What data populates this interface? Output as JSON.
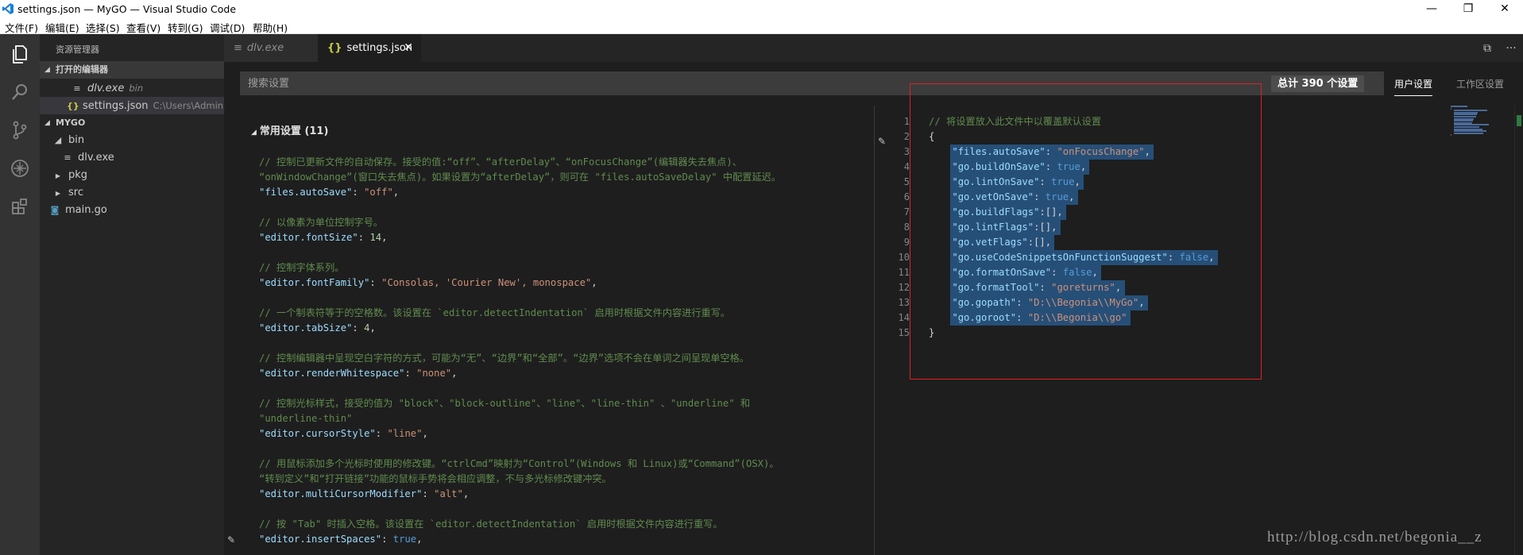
{
  "window": {
    "title": "settings.json — MyGO — Visual Studio Code",
    "controls": {
      "minimize": "—",
      "maximize": "❐",
      "close": "✕"
    }
  },
  "menu": [
    "文件(F)",
    "编辑(E)",
    "选择(S)",
    "查看(V)",
    "转到(G)",
    "调试(D)",
    "帮助(H)"
  ],
  "activity_bar": [
    "files-icon",
    "search-icon",
    "source-control-icon",
    "debug-icon",
    "extensions-icon"
  ],
  "sidebar": {
    "title": "资源管理器",
    "open_editors": {
      "label": "打开的编辑器",
      "items": [
        {
          "name": "dlv.exe",
          "desc": "bin",
          "icon": "≡"
        },
        {
          "name": "settings.json",
          "desc": "C:\\Users\\Adminis...",
          "icon": "{}"
        }
      ]
    },
    "workspace": {
      "label": "MYGO",
      "items": [
        {
          "name": "bin",
          "arrow": "◢"
        },
        {
          "name": "dlv.exe",
          "icon": "≡"
        },
        {
          "name": "pkg",
          "arrow": "▶"
        },
        {
          "name": "src",
          "arrow": "▶"
        },
        {
          "name": "main.go",
          "icon": "◙"
        }
      ]
    }
  },
  "tabs": [
    {
      "label": "dlv.exe",
      "icon": "≡"
    },
    {
      "label": "settings.json",
      "icon": "{}",
      "close": "✕"
    }
  ],
  "tab_actions": {
    "split": "⧉",
    "more": "···"
  },
  "settings": {
    "search_placeholder": "搜索设置",
    "count": "总计 390 个设置",
    "user_tab": "用户设置",
    "workspace_tab": "工作区设置"
  },
  "default_settings": {
    "group_header": "常用设置 (11)",
    "lines": [
      [
        {
          "t": "// 控制已更新文件的自动保存。接受的值:“off”、“afterDelay”、“onFocusChange”(编辑器失去焦点)、",
          "c": "cm"
        }
      ],
      [
        {
          "t": "“onWindowChange”(窗口失去焦点)。如果设置为“afterDelay”，则可在 \"files.autoSaveDelay\" 中配置延迟。",
          "c": "cm"
        }
      ],
      [
        {
          "t": "\"files.autoSave\"",
          "c": "ky"
        },
        {
          "t": ": ",
          "c": "pn"
        },
        {
          "t": "\"off\"",
          "c": "st"
        },
        {
          "t": ",",
          "c": "pn"
        }
      ],
      [],
      [
        {
          "t": "// 以像素为单位控制字号。",
          "c": "cm"
        }
      ],
      [
        {
          "t": "\"editor.fontSize\"",
          "c": "ky"
        },
        {
          "t": ": ",
          "c": "pn"
        },
        {
          "t": "14",
          "c": "nm"
        },
        {
          "t": ",",
          "c": "pn"
        }
      ],
      [],
      [
        {
          "t": "// 控制字体系列。",
          "c": "cm"
        }
      ],
      [
        {
          "t": "\"editor.fontFamily\"",
          "c": "ky"
        },
        {
          "t": ": ",
          "c": "pn"
        },
        {
          "t": "\"Consolas, 'Courier New', monospace\"",
          "c": "st"
        },
        {
          "t": ",",
          "c": "pn"
        }
      ],
      [],
      [
        {
          "t": "// 一个制表符等于的空格数。该设置在 `editor.detectIndentation` 启用时根据文件内容进行重写。",
          "c": "cm"
        }
      ],
      [
        {
          "t": "\"editor.tabSize\"",
          "c": "ky"
        },
        {
          "t": ": ",
          "c": "pn"
        },
        {
          "t": "4",
          "c": "nm"
        },
        {
          "t": ",",
          "c": "pn"
        }
      ],
      [],
      [
        {
          "t": "// 控制编辑器中呈现空白字符的方式，可能为“无”、“边界”和“全部”。“边界”选项不会在单词之间呈现单空格。",
          "c": "cm"
        }
      ],
      [
        {
          "t": "\"editor.renderWhitespace\"",
          "c": "ky"
        },
        {
          "t": ": ",
          "c": "pn"
        },
        {
          "t": "\"none\"",
          "c": "st"
        },
        {
          "t": ",",
          "c": "pn"
        }
      ],
      [],
      [
        {
          "t": "// 控制光标样式，接受的值为 \"block\"、\"block-outline\"、\"line\"、\"line-thin\" 、\"underline\" 和",
          "c": "cm"
        }
      ],
      [
        {
          "t": "\"underline-thin\"",
          "c": "cm"
        }
      ],
      [
        {
          "t": "\"editor.cursorStyle\"",
          "c": "ky"
        },
        {
          "t": ": ",
          "c": "pn"
        },
        {
          "t": "\"line\"",
          "c": "st"
        },
        {
          "t": ",",
          "c": "pn"
        }
      ],
      [],
      [
        {
          "t": "// 用鼠标添加多个光标时使用的修改键。“ctrlCmd”映射为“Control”(Windows 和 Linux)或“Command”(OSX)。",
          "c": "cm"
        }
      ],
      [
        {
          "t": "“转到定义”和“打开链接”功能的鼠标手势将会相应调整，不与多光标修改键冲突。",
          "c": "cm"
        }
      ],
      [
        {
          "t": "\"editor.multiCursorModifier\"",
          "c": "ky"
        },
        {
          "t": ": ",
          "c": "pn"
        },
        {
          "t": "\"alt\"",
          "c": "st"
        },
        {
          "t": ",",
          "c": "pn"
        }
      ],
      [],
      [
        {
          "t": "// 按 \"Tab\" 时插入空格。该设置在 `editor.detectIndentation` 启用时根据文件内容进行重写。",
          "c": "cm"
        }
      ],
      [
        {
          "t": "\"editor.insertSpaces\"",
          "c": "ky"
        },
        {
          "t": ": ",
          "c": "pn"
        },
        {
          "t": "true",
          "c": "kw"
        },
        {
          "t": ",",
          "c": "pn"
        }
      ]
    ]
  },
  "user_settings": {
    "line_numbers": [
      "1",
      "2",
      "3",
      "4",
      "5",
      "6",
      "7",
      "8",
      "9",
      "10",
      "11",
      "12",
      "13",
      "14",
      "15"
    ],
    "lines": [
      [
        {
          "t": "// 将设置放入此文件中以覆盖默认设置",
          "c": "cm"
        }
      ],
      [
        {
          "t": "{",
          "c": "pn"
        }
      ],
      [
        {
          "t": "    ",
          "c": "pn"
        },
        {
          "t": "\"files.autoSave\"",
          "c": "ky"
        },
        {
          "t": ": ",
          "c": "pn"
        },
        {
          "t": "\"onFocusChange\"",
          "c": "st"
        },
        {
          "t": ",",
          "c": "pn"
        }
      ],
      [
        {
          "t": "    ",
          "c": "pn"
        },
        {
          "t": "\"go.buildOnSave\"",
          "c": "ky"
        },
        {
          "t": ": ",
          "c": "pn"
        },
        {
          "t": "true",
          "c": "kw"
        },
        {
          "t": ",",
          "c": "pn"
        }
      ],
      [
        {
          "t": "    ",
          "c": "pn"
        },
        {
          "t": "\"go.lintOnSave\"",
          "c": "ky"
        },
        {
          "t": ": ",
          "c": "pn"
        },
        {
          "t": "true",
          "c": "kw"
        },
        {
          "t": ",",
          "c": "pn"
        }
      ],
      [
        {
          "t": "    ",
          "c": "pn"
        },
        {
          "t": "\"go.vetOnSave\"",
          "c": "ky"
        },
        {
          "t": ": ",
          "c": "pn"
        },
        {
          "t": "true",
          "c": "kw"
        },
        {
          "t": ",",
          "c": "pn"
        }
      ],
      [
        {
          "t": "    ",
          "c": "pn"
        },
        {
          "t": "\"go.buildFlags\"",
          "c": "ky"
        },
        {
          "t": ":[],",
          "c": "pn"
        }
      ],
      [
        {
          "t": "    ",
          "c": "pn"
        },
        {
          "t": "\"go.lintFlags\"",
          "c": "ky"
        },
        {
          "t": ":[],",
          "c": "pn"
        }
      ],
      [
        {
          "t": "    ",
          "c": "pn"
        },
        {
          "t": "\"go.vetFlags\"",
          "c": "ky"
        },
        {
          "t": ":[],",
          "c": "pn"
        }
      ],
      [
        {
          "t": "    ",
          "c": "pn"
        },
        {
          "t": "\"go.useCodeSnippetsOnFunctionSuggest\"",
          "c": "ky"
        },
        {
          "t": ": ",
          "c": "pn"
        },
        {
          "t": "false",
          "c": "kw"
        },
        {
          "t": ",",
          "c": "pn"
        }
      ],
      [
        {
          "t": "    ",
          "c": "pn"
        },
        {
          "t": "\"go.formatOnSave\"",
          "c": "ky"
        },
        {
          "t": ": ",
          "c": "pn"
        },
        {
          "t": "false",
          "c": "kw"
        },
        {
          "t": ",",
          "c": "pn"
        }
      ],
      [
        {
          "t": "    ",
          "c": "pn"
        },
        {
          "t": "\"go.formatTool\"",
          "c": "ky"
        },
        {
          "t": ": ",
          "c": "pn"
        },
        {
          "t": "\"goreturns\"",
          "c": "st"
        },
        {
          "t": ",",
          "c": "pn"
        }
      ],
      [
        {
          "t": "    ",
          "c": "pn"
        },
        {
          "t": "\"go.gopath\"",
          "c": "ky"
        },
        {
          "t": ": ",
          "c": "pn"
        },
        {
          "t": "\"D:\\\\Begonia\\\\MyGo\"",
          "c": "st"
        },
        {
          "t": ",",
          "c": "pn"
        }
      ],
      [
        {
          "t": "    ",
          "c": "pn"
        },
        {
          "t": "\"go.goroot\"",
          "c": "ky"
        },
        {
          "t": ": ",
          "c": "pn"
        },
        {
          "t": "\"D:\\\\Begonia\\\\go\"",
          "c": "st"
        }
      ],
      [
        {
          "t": "}",
          "c": "pn"
        }
      ]
    ]
  },
  "watermark": "http://blog.csdn.net/begonia__z"
}
